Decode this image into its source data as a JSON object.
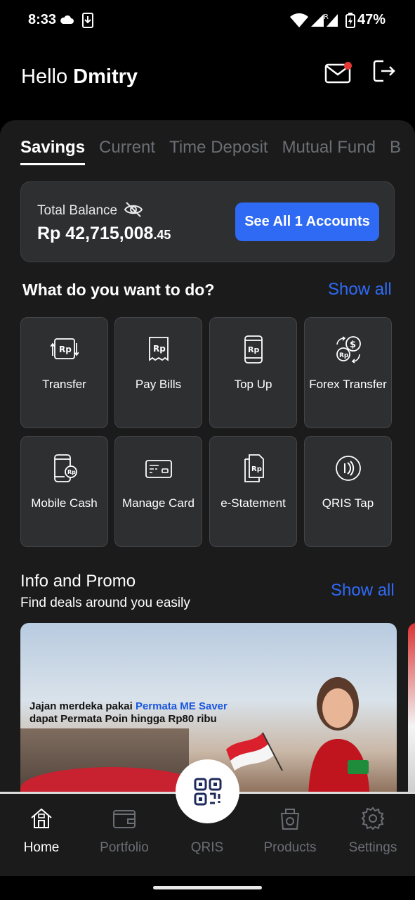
{
  "status_bar": {
    "time": "8:33",
    "battery": "47%"
  },
  "header": {
    "greeting_prefix": "Hello",
    "user_name": "Dmitry"
  },
  "tabs": [
    {
      "label": "Savings",
      "active": true
    },
    {
      "label": "Current",
      "active": false
    },
    {
      "label": "Time Deposit",
      "active": false
    },
    {
      "label": "Mutual Fund",
      "active": false
    },
    {
      "label": "B",
      "active": false
    }
  ],
  "balance": {
    "label": "Total Balance",
    "currency": "Rp",
    "amount_main": "Rp 42,715,008",
    "amount_cents": ".45",
    "accounts_button": "See All 1 Accounts"
  },
  "actions": {
    "title": "What do you want to do?",
    "show_all": "Show all",
    "items": [
      {
        "label": "Transfer",
        "icon": "transfer-icon"
      },
      {
        "label": "Pay Bills",
        "icon": "bill-icon"
      },
      {
        "label": "Top Up",
        "icon": "phone-topup-icon"
      },
      {
        "label": "Forex Transfer",
        "icon": "forex-icon"
      },
      {
        "label": "Mobile Cash",
        "icon": "mobile-cash-icon"
      },
      {
        "label": "Manage Card",
        "icon": "card-icon"
      },
      {
        "label": "e-Statement",
        "icon": "statement-icon"
      },
      {
        "label": "QRIS Tap",
        "icon": "contactless-icon"
      }
    ]
  },
  "promo": {
    "title": "Info and Promo",
    "subtitle": "Find deals around you easily",
    "show_all": "Show all",
    "banner_line1_prefix": "Jajan merdeka pakai ",
    "banner_line1_highlight": "Permata ME Saver",
    "banner_line2": "dapat Permata Poin hingga Rp80 ribu"
  },
  "bottom_nav": [
    {
      "label": "Home",
      "icon": "home-icon",
      "active": true
    },
    {
      "label": "Portfolio",
      "icon": "wallet-icon",
      "active": false
    },
    {
      "label": "QRIS",
      "icon": "qr-code-icon",
      "active": false
    },
    {
      "label": "Products",
      "icon": "products-icon",
      "active": false
    },
    {
      "label": "Settings",
      "icon": "gear-icon",
      "active": false
    }
  ],
  "colors": {
    "accent": "#2f6af5",
    "background": "#000000",
    "surface": "#1b1b1c",
    "tile": "#2e2f31",
    "notification": "#e53935"
  }
}
